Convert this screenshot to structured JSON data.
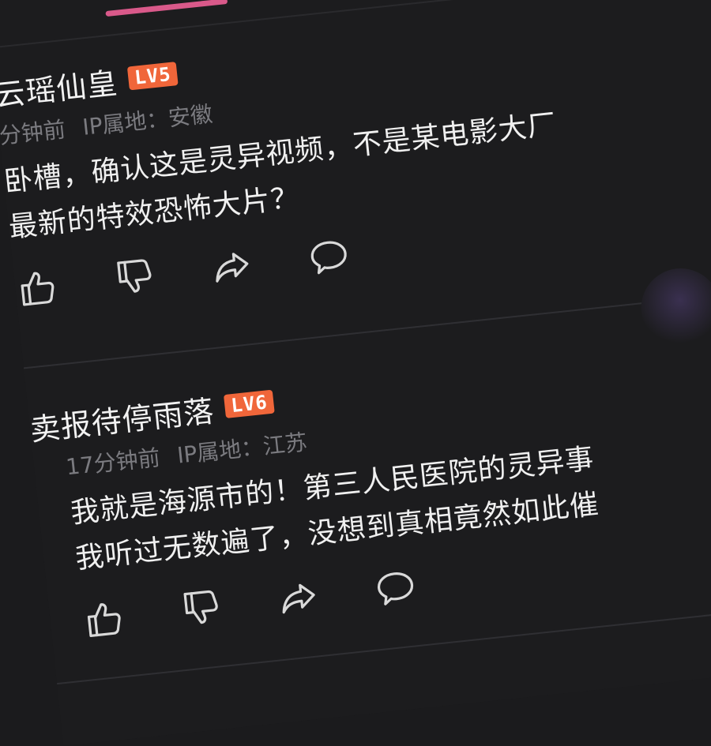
{
  "comments": [
    {
      "username": "云瑶仙皇",
      "level": "LV5",
      "time": "分钟前",
      "ip_label": "IP属地：安徽",
      "text": "卧槽，确认这是灵异视频，不是某电影大厂\n最新的特效恐怖大片？"
    },
    {
      "username": "卖报待停雨落",
      "level": "LV6",
      "time": "17分钟前",
      "ip_label": "IP属地：江苏",
      "text": "我就是海源市的！第三人民医院的灵异事\n我听过无数遍了，没想到真相竟然如此催"
    }
  ],
  "icons": [
    "like-icon",
    "dislike-icon",
    "share-icon",
    "comment-icon"
  ],
  "colors": {
    "background": "#1c1c1e",
    "accent": "#d9598a",
    "badge": "#f0663a"
  }
}
